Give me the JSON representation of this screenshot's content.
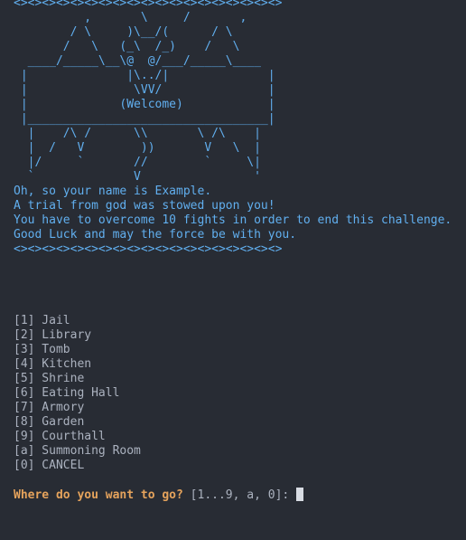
{
  "colors": {
    "background": "#282c34",
    "banner": "#61afef",
    "text": "#abb2bf",
    "prompt": "#e5a35c",
    "cursor": "#d8dce3"
  },
  "banner": {
    "divider_top": "<><><><><><><><><><><><><><><><><><><>",
    "art": [
      "          ,       \\     /       ,",
      "        / \\     )\\__/(      / \\",
      "       /   \\   (_\\  /_)    /   \\",
      "  ____/_____\\__\\@  @/___/_____\\____",
      " |              |\\../|              |",
      " |               \\VV/               |",
      " |             (Welcome)            |",
      " |__________________________________|",
      "  |    /\\ /      \\\\       \\ /\\    |",
      "  |  /   V        ))       V   \\  |",
      "  |/     `       //        `     \\|",
      "  `              V                '"
    ],
    "messages": [
      "Oh, so your name is Example.",
      "A trial from god was stowed upon you!",
      "You have to overcome 10 fights in order to end this challenge.",
      "Good Luck and may the force be with you."
    ],
    "divider_bottom": "<><><><><><><><><><><><><><><><><><><>"
  },
  "menu": {
    "options": [
      "[1] Jail",
      "[2] Library",
      "[3] Tomb",
      "[4] Kitchen",
      "[5] Shrine",
      "[6] Eating Hall",
      "[7] Armory",
      "[8] Garden",
      "[9] Courthall",
      "[a] Summoning Room",
      "[0] CANCEL"
    ]
  },
  "prompt": {
    "question": "Where do you want to go?",
    "choices": " [1...9, a, 0]: "
  }
}
